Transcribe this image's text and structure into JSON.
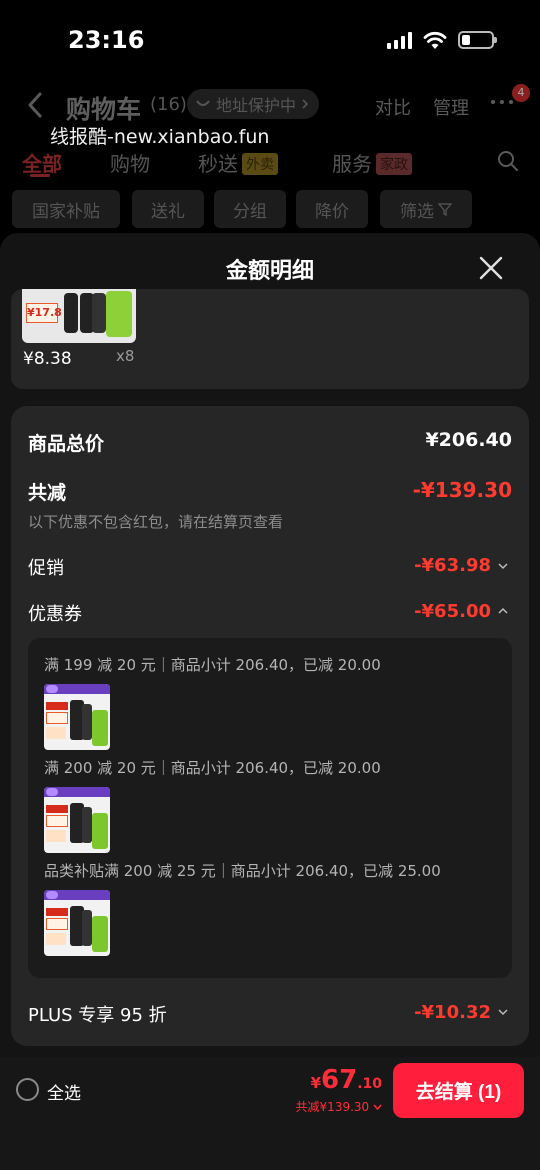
{
  "status_bar": {
    "time": "23:16"
  },
  "cart_header": {
    "title": "购物车",
    "count": "(16)",
    "address_protection": "地址保护中",
    "compare": "对比",
    "manage": "管理",
    "more_badge": "4"
  },
  "watermark": "线报酷-new.xianbao.fun",
  "category_tabs": [
    {
      "label": "全部"
    },
    {
      "label": "购物"
    },
    {
      "label": "秒送",
      "badge": "外卖"
    },
    {
      "label": "服务",
      "badge": "家政"
    }
  ],
  "filter_chips": [
    "国家补贴",
    "送礼",
    "分组",
    "降价",
    "筛选"
  ],
  "sheet": {
    "title": "金额明细",
    "item": {
      "thumb_tag": "¥17.8",
      "price": "¥8.38",
      "qty": "x8"
    },
    "total": {
      "label": "商品总价",
      "value": "¥206.40"
    },
    "reduction": {
      "label": "共减",
      "value": "-¥139.30",
      "note": "以下优惠不包含红包，请在结算页查看"
    },
    "promotion": {
      "label": "促销",
      "value": "-¥63.98"
    },
    "coupon": {
      "label": "优惠券",
      "value": "-¥65.00",
      "entries": [
        {
          "text": "满 199 减 20 元｜商品小计 206.40，已减 20.00"
        },
        {
          "text": "满 200 减 20 元｜商品小计 206.40，已减 20.00"
        },
        {
          "text": "品类补贴满 200 减 25 元｜商品小计 206.40，已减 25.00"
        }
      ]
    },
    "plus": {
      "label": "PLUS 专享 95 折",
      "value": "-¥10.32"
    }
  },
  "bottom_bar": {
    "select_all": "全选",
    "currency": "¥",
    "total_int": "67",
    "total_dec": ".10",
    "saved": "共减¥139.30",
    "checkout": "去结算 (1)"
  },
  "colors": {
    "accent_red": "#ff2d3a",
    "checkout_red": "#ff1e3c",
    "sheet_bg": "#141414",
    "card_bg": "#262626"
  }
}
